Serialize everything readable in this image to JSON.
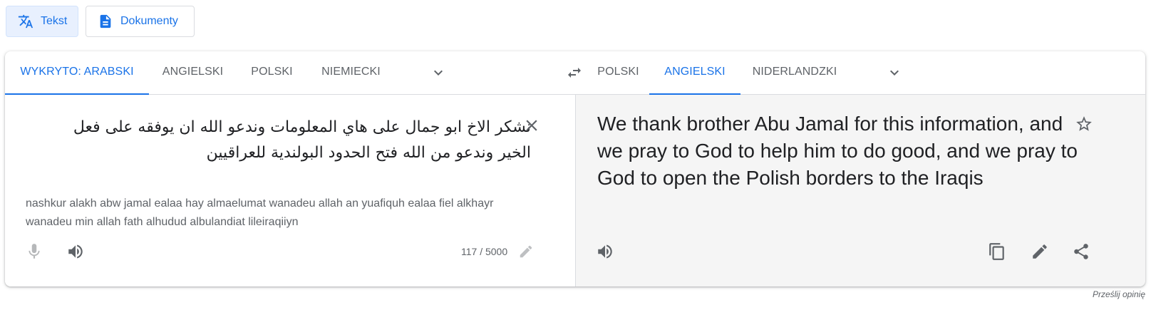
{
  "modes": {
    "text_label": "Tekst",
    "documents_label": "Dokumenty"
  },
  "source_langs": [
    "WYKRYTO: ARABSKI",
    "ANGIELSKI",
    "POLSKI",
    "NIEMIECKI"
  ],
  "target_langs": [
    "POLSKI",
    "ANGIELSKI",
    "NIDERLANDZKI"
  ],
  "source": {
    "text": "نشكر الاخ ابو جمال على هاي المعلومات وندعو الله ان يوفقه على فعل الخير وندعو من الله فتح الحدود البولندية للعراقيين",
    "transliteration": "nashkur alakh abw jamal ealaa hay almaelumat wanadeu allah an yuafiquh ealaa fiel alkhayr wanadeu min allah fath alhudud albulandiat lileiraqiiyn",
    "char_count": "117 / 5000"
  },
  "target": {
    "text": "We thank brother Abu Jamal for this information, and we pray to God to help him to do good, and we pray to God to open the Polish borders to the Iraqis"
  },
  "footer": {
    "feedback_label": "Prześlij opinię"
  },
  "colors": {
    "accent": "#1a73e8",
    "icon": "#5f6368",
    "target_bg": "#f5f5f5"
  }
}
